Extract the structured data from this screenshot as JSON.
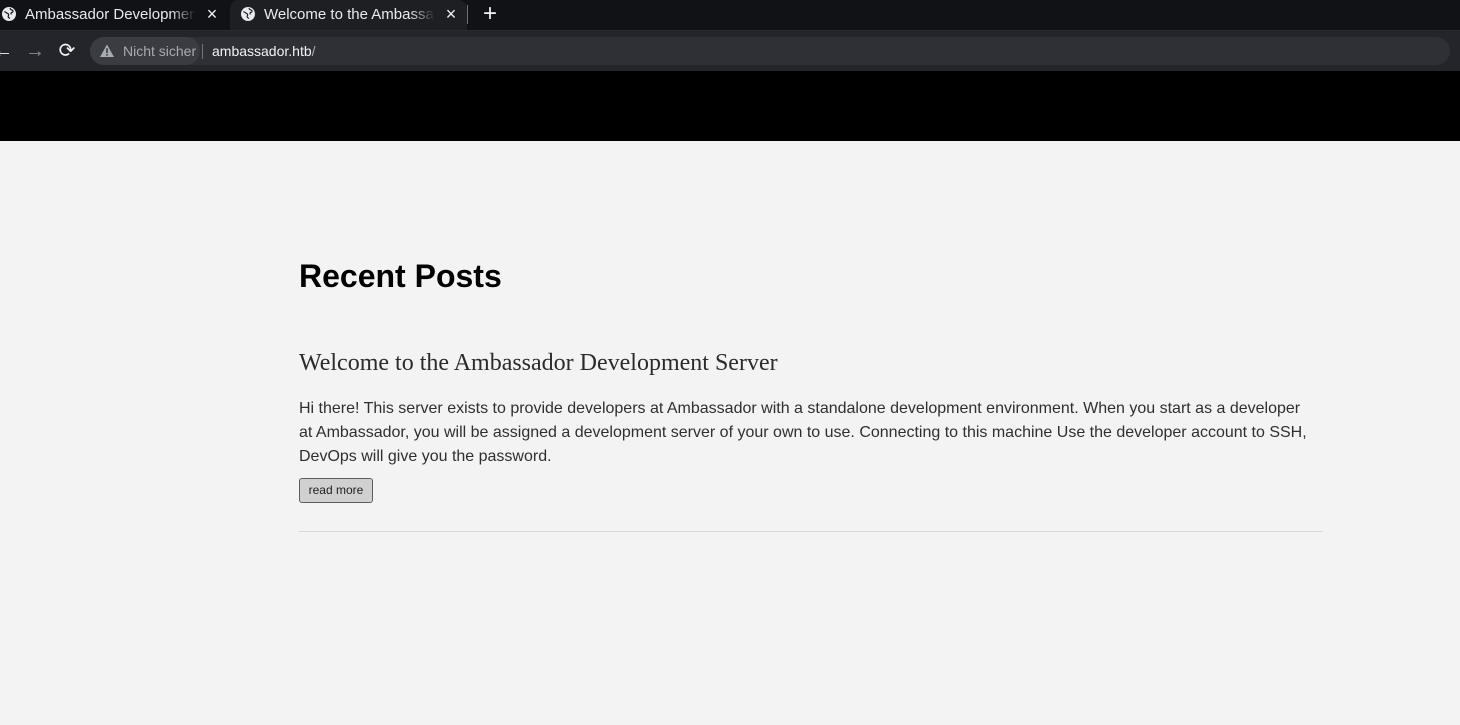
{
  "browser": {
    "tabs": [
      {
        "title": "Ambassador Development Server",
        "icon": "globe-icon",
        "close_label": "×"
      },
      {
        "title": "Welcome to the Ambassador Development Server",
        "icon": "globe-icon",
        "close_label": "×"
      }
    ],
    "new_tab_label": "+",
    "navigation": {
      "back_label": "←",
      "forward_label": "→",
      "reload_label": "⟳"
    },
    "address_bar": {
      "security_label": "Nicht sicher",
      "host": "ambassador.htb",
      "path": "/",
      "security_icon": "warning-icon"
    }
  },
  "page": {
    "section_title": "Recent Posts",
    "post": {
      "title": "Welcome to the Ambassador Development Server",
      "excerpt": "Hi there! This server exists to provide developers at Ambassador with a standalone development environment. When you start as a developer at Ambassador, you will be assigned a development server of your own to use. Connecting to this machine Use the developer account to SSH, DevOps will give you the password.",
      "button_label": "read more"
    }
  }
}
